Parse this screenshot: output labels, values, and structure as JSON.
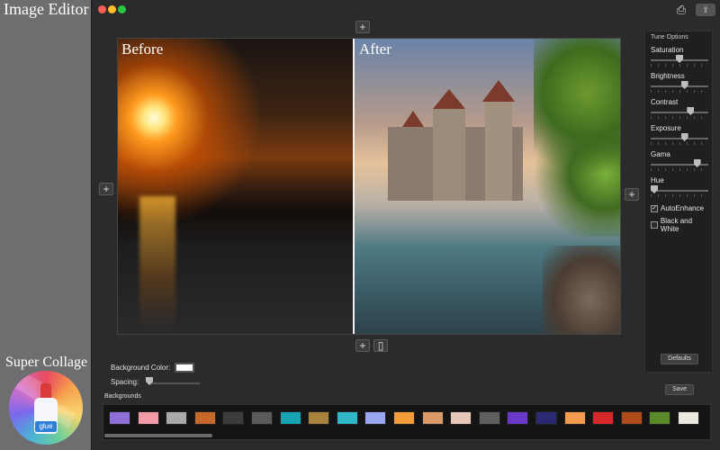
{
  "promo": {
    "title": "Image Editor",
    "bottom_title": "Super Collage",
    "icon_text": "glue"
  },
  "window": {
    "icons": {
      "print": "printer-icon",
      "share": "share-icon",
      "add": "plus-icon",
      "trash": "trash-icon"
    }
  },
  "canvas": {
    "before_label": "Before",
    "after_label": "After"
  },
  "tune": {
    "title": "Tune Options",
    "sliders": [
      {
        "label": "Saturation",
        "value": 0.5
      },
      {
        "label": "Brightness",
        "value": 0.6
      },
      {
        "label": "Contrast",
        "value": 0.72
      },
      {
        "label": "Exposure",
        "value": 0.6
      },
      {
        "label": "Gama",
        "value": 0.85
      },
      {
        "label": "Hue",
        "value": 0.0
      }
    ],
    "checkboxes": [
      {
        "label": "AutoEnhance",
        "checked": true
      },
      {
        "label": "Black and White",
        "checked": false
      }
    ],
    "defaults_label": "Defaults"
  },
  "bottom": {
    "bg_color_label": "Background Color:",
    "bg_color": "#ffffff",
    "spacing_label": "Spacing:",
    "spacing_value": 0.0,
    "save_label": "Save",
    "backgrounds_label": "Backgrounds",
    "backgrounds": [
      "#8e6fd8",
      "#f29aa8",
      "#a9a9a9",
      "#c7682a",
      "#3c3c3c",
      "#5a5a5a",
      "#17a3b3",
      "#a8813c",
      "#2fb7c9",
      "#9aa7f0",
      "#f39b3a",
      "#d99a6a",
      "#e8c6b8",
      "#5f5f5f",
      "#6a38c9",
      "#2a2a72",
      "#f49a4c",
      "#d62828",
      "#b04a1a",
      "#5a8a2a",
      "#ece8df"
    ]
  }
}
